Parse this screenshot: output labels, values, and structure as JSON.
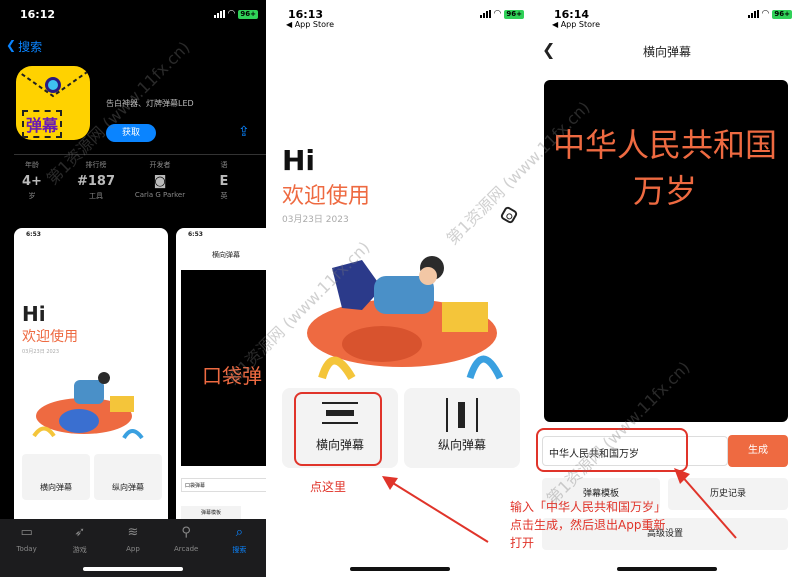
{
  "panel1": {
    "time": "16:12",
    "battery": "96+",
    "back_label": "搜索",
    "app_icon_text": "弹幕",
    "subtitle": "告白神器、灯牌弹幕LED",
    "get_label": "获取",
    "stats": [
      {
        "header": "年龄",
        "value": "4+",
        "sub": "岁"
      },
      {
        "header": "排行榜",
        "value": "#187",
        "sub": "工具"
      },
      {
        "header": "开发者",
        "value": "",
        "sub": "Carla G Parker"
      },
      {
        "header": "语",
        "value": "E",
        "sub": "英"
      }
    ],
    "shot1": {
      "time": "6:53",
      "hi": "Hi",
      "welcome": "欢迎使用",
      "date": "03月23日 2023",
      "card1": "横向弹幕",
      "card2": "纵向弹幕"
    },
    "shot2": {
      "time": "6:53",
      "title": "横向弹幕",
      "red_text": "口袋弹",
      "input": "口袋弹幕",
      "btn": "弹幕模板"
    },
    "tabs": [
      {
        "label": "Today",
        "icon": "today-icon"
      },
      {
        "label": "游戏",
        "icon": "rocket-icon"
      },
      {
        "label": "App",
        "icon": "layers-icon"
      },
      {
        "label": "Arcade",
        "icon": "joystick-icon"
      },
      {
        "label": "搜索",
        "icon": "search-icon"
      }
    ]
  },
  "panel2": {
    "time": "16:13",
    "sub": "◀ App Store",
    "battery": "96+",
    "hi": "Hi",
    "welcome": "欢迎使用",
    "date": "03月23日 2023",
    "card1": "横向弹幕",
    "card2": "纵向弹幕",
    "annotation": "点这里"
  },
  "panel3": {
    "time": "16:14",
    "sub": "◀ App Store",
    "battery": "96+",
    "title": "横向弹幕",
    "preview_text": "中华人民共和国万岁",
    "input_value": "中华人民共和国万岁",
    "generate_label": "生成",
    "template_label": "弹幕模板",
    "history_label": "历史记录",
    "advanced_label": "高级设置",
    "annotation_line1": "输入「中华人民共和国万岁」",
    "annotation_line2": "点击生成，然后退出App重新",
    "annotation_line3": "打开"
  },
  "watermark": "第1资源网 (www.11fx.cn)",
  "colors": {
    "accent": "#ee6a41",
    "blue": "#0a84ff",
    "red": "#e0342a"
  }
}
